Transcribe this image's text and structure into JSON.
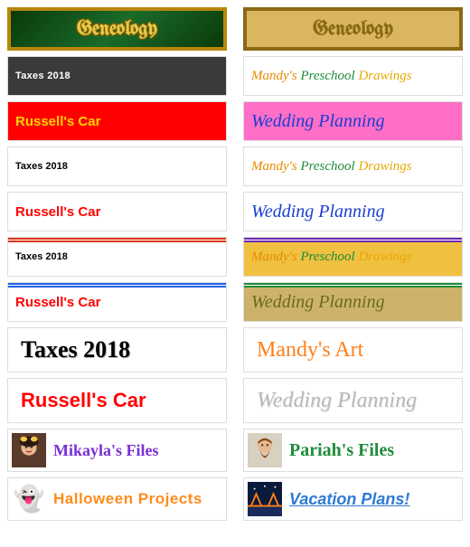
{
  "rows": [
    {
      "left": {
        "text": "Geneology"
      },
      "right": {
        "text": "Geneology"
      }
    },
    {
      "left": {
        "text": "Taxes 2018"
      },
      "right": {
        "w1": "Mandy's",
        "w2": "Preschool",
        "w3": "Drawings"
      }
    },
    {
      "left": {
        "text": "Russell's Car"
      },
      "right": {
        "text": "Wedding Planning"
      }
    },
    {
      "left": {
        "text": "Taxes 2018"
      },
      "right": {
        "w1": "Mandy's",
        "w2": "Preschool",
        "w3": "Drawings"
      }
    },
    {
      "left": {
        "text": "Russell's Car"
      },
      "right": {
        "text": "Wedding Planning"
      }
    },
    {
      "left": {
        "text": "Taxes 2018"
      },
      "right": {
        "w1": "Mandy's",
        "w2": "Preschool",
        "w3": "Drawings"
      }
    },
    {
      "left": {
        "text": "Russell's Car"
      },
      "right": {
        "text": "Wedding Planning"
      }
    },
    {
      "left": {
        "text": "Taxes 2018"
      },
      "right": {
        "text": "Mandy's Art"
      }
    },
    {
      "left": {
        "text": "Russell's Car"
      },
      "right": {
        "text": "Wedding Planning"
      }
    },
    {
      "left": {
        "text": "Mikayla's Files"
      },
      "right": {
        "text": "Pariah's Files"
      }
    },
    {
      "left": {
        "text": "Halloween Projects"
      },
      "right": {
        "text": "Vacation Plans!"
      }
    }
  ],
  "icons": {
    "mikayla": "avatar-girl",
    "pariah": "avatar-man",
    "halloween": "ghost-emoji",
    "vacation": "bridge-night"
  }
}
